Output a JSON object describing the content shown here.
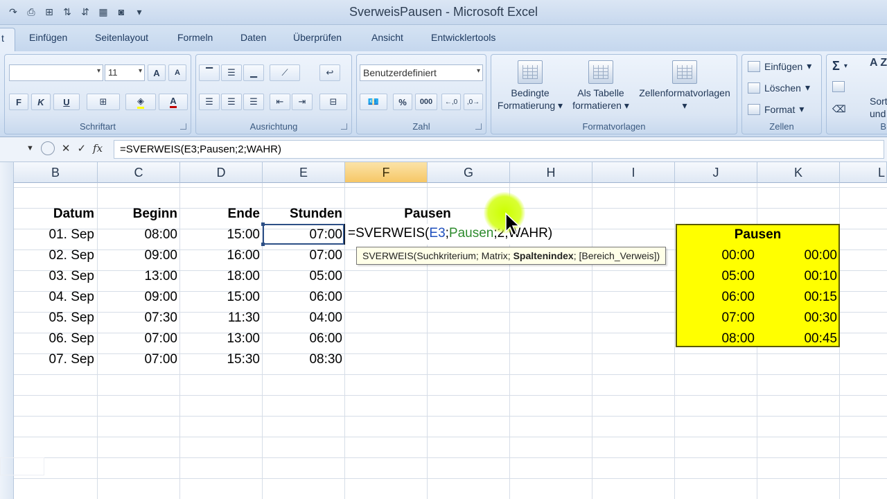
{
  "window": {
    "title": "SverweisPausen - Microsoft Excel"
  },
  "quick_access": [
    "redo-icon",
    "sort-icon",
    "filter-icon",
    "sort-az-icon",
    "sort-za-icon",
    "freeze-icon",
    "camera-icon",
    "customize-icon"
  ],
  "ribbon": {
    "active_tab_fragment": "t",
    "tabs": [
      "Einfügen",
      "Seitenlayout",
      "Formeln",
      "Daten",
      "Überprüfen",
      "Ansicht",
      "Entwicklertools"
    ],
    "font": {
      "size": "11",
      "bold": "F",
      "italic": "K",
      "underline": "U",
      "grow": "A",
      "shrink": "A",
      "color_letter": "A",
      "label": "Schriftart"
    },
    "alignment": {
      "label": "Ausrichtung"
    },
    "number": {
      "format": "Benutzerdefiniert",
      "percent": "%",
      "thousands": "000",
      "inc_decimal": "⁰₀",
      "dec_decimal": "⁰₀",
      "label": "Zahl"
    },
    "styles": {
      "conditional": [
        "Bedingte",
        "Formatierung"
      ],
      "as_table": [
        "Als Tabelle",
        "formatieren"
      ],
      "cell_styles": [
        "Zellenformatvorlagen"
      ],
      "label": "Formatvorlagen"
    },
    "cells": {
      "insert": "Einfügen",
      "delete": "Löschen",
      "format": "Format",
      "label": "Zellen"
    },
    "editing": {
      "sum": "Σ",
      "sort_1": "Sort",
      "sort_2": "und F",
      "label_fragment": "B",
      "az": "A Z"
    }
  },
  "formula_bar": {
    "content": "=SVERWEIS(E3;Pausen;2;WAHR)",
    "fx": "fx"
  },
  "columns": [
    "B",
    "C",
    "D",
    "E",
    "F",
    "G",
    "H",
    "I",
    "J",
    "K",
    "L"
  ],
  "table": {
    "headers": {
      "datum": "Datum",
      "beginn": "Beginn",
      "ende": "Ende",
      "stunden": "Stunden",
      "pausen": "Pausen"
    },
    "rows": [
      {
        "datum": "01. Sep",
        "beginn": "08:00",
        "ende": "15:00",
        "stunden": "07:00"
      },
      {
        "datum": "02. Sep",
        "beginn": "09:00",
        "ende": "16:00",
        "stunden": "07:00"
      },
      {
        "datum": "03. Sep",
        "beginn": "13:00",
        "ende": "18:00",
        "stunden": "05:00"
      },
      {
        "datum": "04. Sep",
        "beginn": "09:00",
        "ende": "15:00",
        "stunden": "06:00"
      },
      {
        "datum": "05. Sep",
        "beginn": "07:30",
        "ende": "11:30",
        "stunden": "04:00"
      },
      {
        "datum": "06. Sep",
        "beginn": "07:00",
        "ende": "13:00",
        "stunden": "06:00"
      },
      {
        "datum": "07. Sep",
        "beginn": "07:00",
        "ende": "15:30",
        "stunden": "08:30"
      }
    ]
  },
  "editing_cell": {
    "eq": "=SVERWEIS(",
    "ref1": "E3",
    "sep1": ";",
    "ref2": "Pausen",
    "rest": ";2;WAHR)"
  },
  "tooltip": {
    "pre": "SVERWEIS(Suchkriterium; Matrix; ",
    "bold": "Spaltenindex",
    "post": "; [Bereich_Verweis])"
  },
  "lookup": {
    "title": "Pausen",
    "rows": [
      {
        "from": "00:00",
        "pause": "00:00"
      },
      {
        "from": "05:00",
        "pause": "00:10"
      },
      {
        "from": "06:00",
        "pause": "00:15"
      },
      {
        "from": "07:00",
        "pause": "00:30"
      },
      {
        "from": "08:00",
        "pause": "00:45"
      }
    ]
  },
  "colors": {
    "lookup_fill": "#ffff00",
    "selected_column": "#f6c766",
    "highlight": "#ccff00"
  }
}
